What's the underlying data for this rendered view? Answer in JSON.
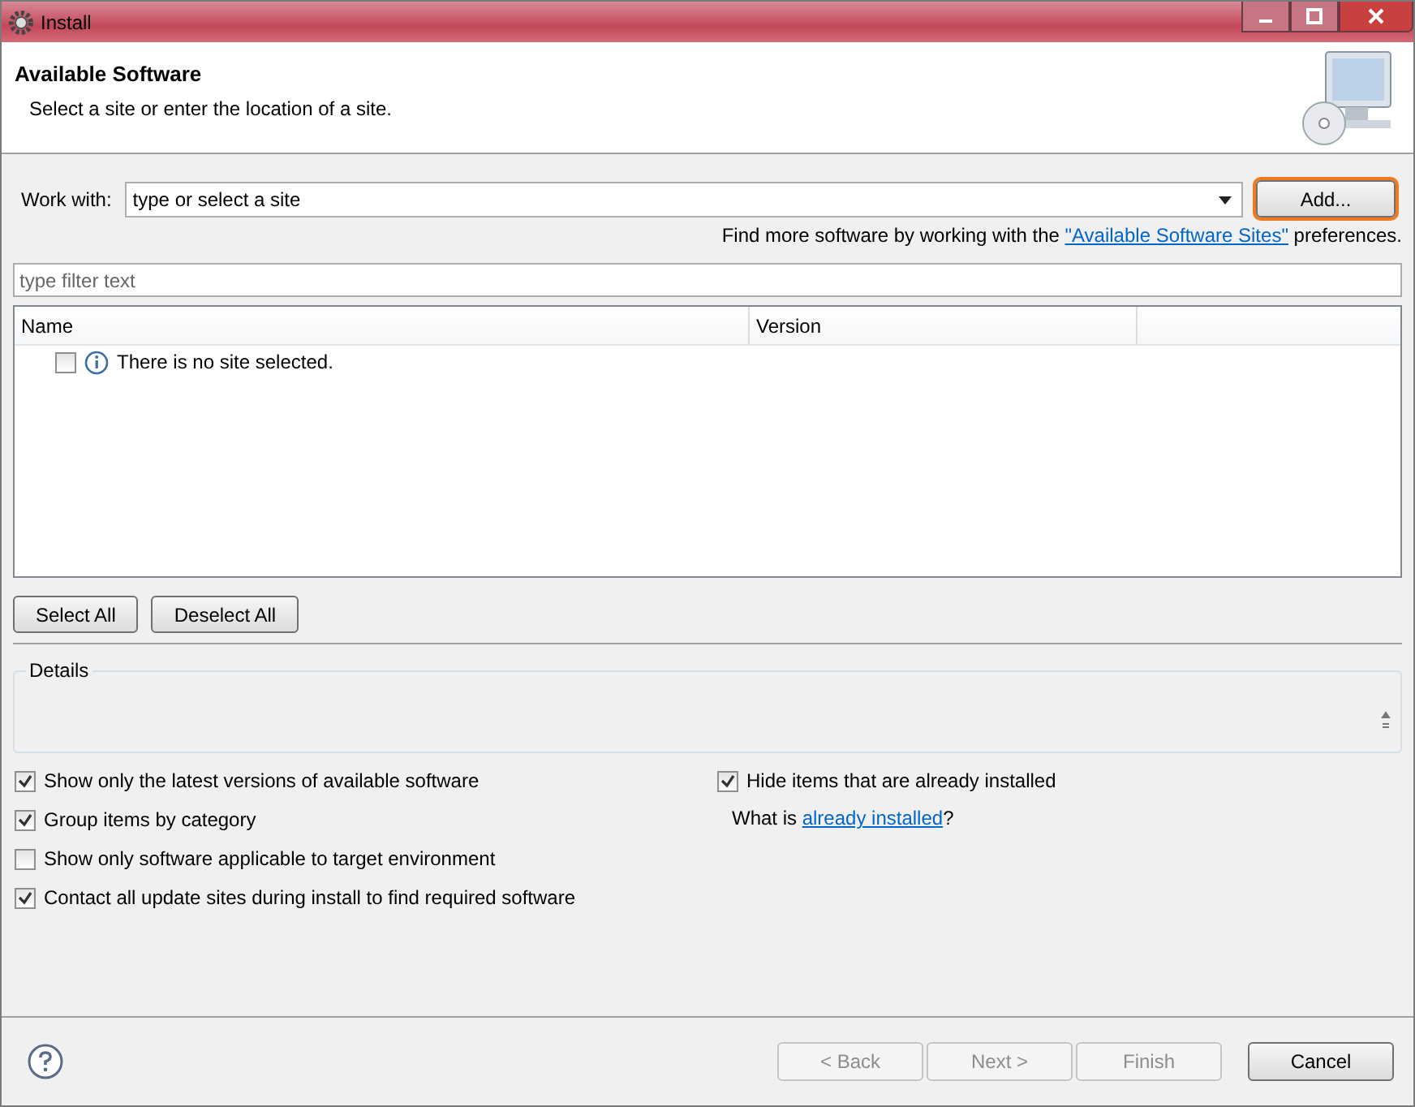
{
  "window": {
    "title": "Install"
  },
  "header": {
    "title": "Available Software",
    "subtitle": "Select a site or enter the location of a site."
  },
  "work_with": {
    "label": "Work with:",
    "placeholder": "type or select a site",
    "add_button": {
      "label": "Add...",
      "highlighted": true
    }
  },
  "find_more": {
    "prefix": "Find more software by working with the",
    "link": "\"Available Software Sites\"",
    "suffix": "preferences."
  },
  "filter": {
    "placeholder": "type filter text"
  },
  "table": {
    "columns": [
      "Name",
      "Version"
    ],
    "rows": [
      {
        "checked": false,
        "text": "There is no site selected."
      }
    ]
  },
  "selection_buttons": [
    "Select All",
    "Deselect All"
  ],
  "details": {
    "title": "Details"
  },
  "options_left": [
    {
      "label": "Show only the latest versions of available software",
      "checked": true
    },
    {
      "label": "Group items by category",
      "checked": true
    },
    {
      "label": "Show only software applicable to target environment",
      "checked": false
    },
    {
      "label": "Contact all update sites during install to find required software",
      "checked": true
    }
  ],
  "options_right": [
    {
      "label": "Hide items that are already installed",
      "checked": true
    }
  ],
  "installed_note": {
    "prefix": "What is",
    "link": "already installed",
    "suffix": "?"
  },
  "footer_buttons": [
    {
      "label": "< Back",
      "disabled": true
    },
    {
      "label": "Next >",
      "disabled": true
    },
    {
      "label": "Finish",
      "disabled": true
    },
    {
      "label": "Cancel",
      "disabled": false
    }
  ]
}
